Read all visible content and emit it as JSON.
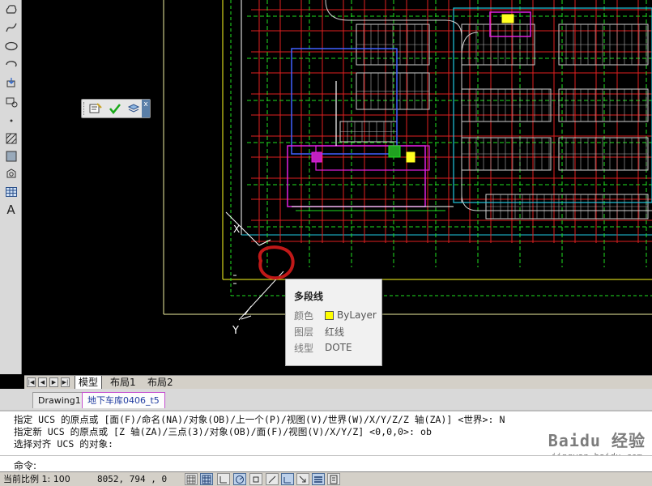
{
  "left_toolbar": {
    "icons": [
      "revcloud-icon",
      "spline-icon",
      "ellipse-icon",
      "ellipse-arc-icon",
      "insert-block-icon",
      "make-block-icon",
      "point-icon",
      "hatch-icon",
      "gradient-icon",
      "region-icon",
      "table-icon",
      "mtext-icon"
    ],
    "text_tool_label": "A"
  },
  "mini_toolbar": {
    "icons": [
      "properties-icon",
      "checkmark-icon",
      "layer-icon"
    ],
    "close_label": "x"
  },
  "drawing": {
    "ucs_label": "Y",
    "axis_x_label": "X"
  },
  "tooltip": {
    "title": "多段线",
    "rows": [
      {
        "key": "颜色",
        "value": "ByLayer",
        "swatch": "#ffff00"
      },
      {
        "key": "图层",
        "value": "红线"
      },
      {
        "key": "线型",
        "value": "DOTE"
      }
    ]
  },
  "layout_tabs": {
    "tabs": [
      "模型",
      "布局1",
      "布局2"
    ],
    "active": "模型"
  },
  "doc_tabs": {
    "tabs": [
      "Drawing1",
      "地下车库0406_t5"
    ],
    "active": "地下车库0406_t5"
  },
  "command": {
    "history": [
      "指定 UCS 的原点或 [面(F)/命名(NA)/对象(OB)/上一个(P)/视图(V)/世界(W)/X/Y/Z/Z 轴(ZA)] <世界>: N",
      "指定新 UCS 的原点或 [Z 轴(ZA)/三点(3)/对象(OB)/面(F)/视图(V)/X/Y/Z] <0,0,0>: ob",
      "选择对齐 UCS 的对象:"
    ],
    "prompt_label": "命令:",
    "input_value": "",
    "watermark_line1": "Baidu 经验",
    "watermark_line2": "jingyan.baidu.com"
  },
  "statusbar": {
    "scale": "当前比例 1: 100",
    "coords": "8052,    794    , 0",
    "buttons": [
      "snap-icon",
      "grid-icon",
      "ortho-icon",
      "polar-icon",
      "osnap-icon",
      "otrack-icon",
      "ducs-icon",
      "dyn-icon",
      "lwt-icon",
      "qp-icon"
    ]
  },
  "colors": {
    "red": "#e02020",
    "green": "#20e020",
    "yellow": "#ffff20",
    "white": "#ffffff",
    "cyan": "#20c8e0",
    "magenta": "#e020e0",
    "annotation": "#c01818"
  }
}
